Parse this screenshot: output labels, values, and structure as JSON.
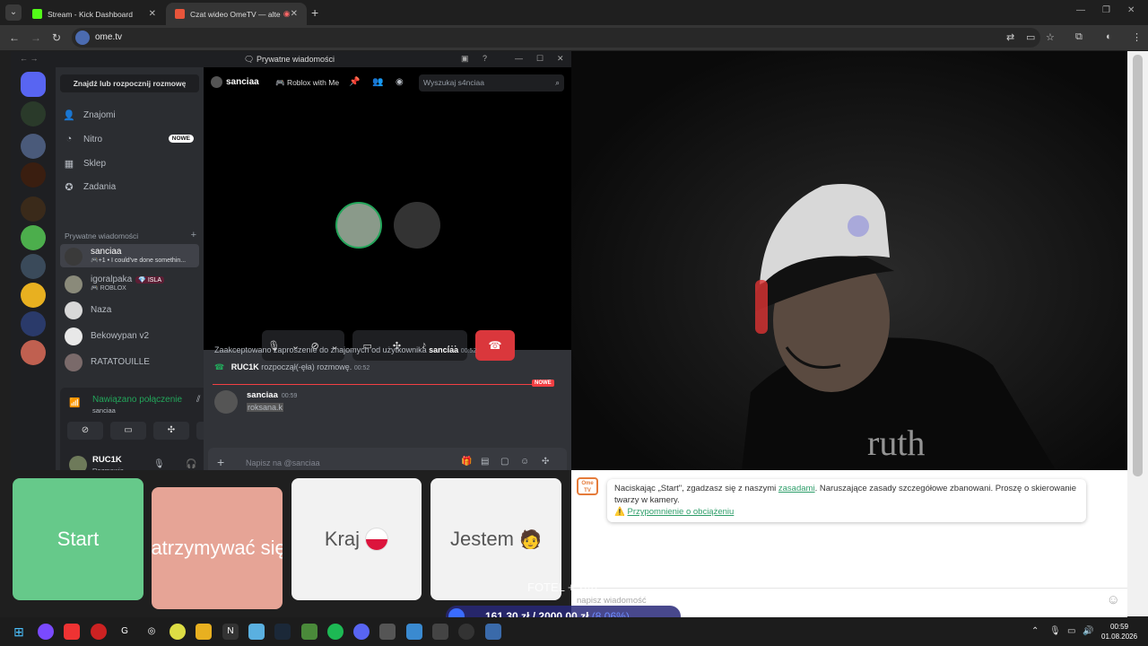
{
  "browser": {
    "tabs": [
      {
        "title": "Stream - Kick Dashboard",
        "fav_color": "#53fc18"
      },
      {
        "title": "Czat wideo OmeTV — altern",
        "fav_color": "#e8553b"
      }
    ],
    "url": "ome.tv"
  },
  "discord": {
    "window_title": "Prywatne wiadomości",
    "find_label": "Znajdź lub rozpocznij rozmowę",
    "nav": [
      {
        "label": "Znajomi",
        "icon": "friends-icon",
        "glyph": "👤"
      },
      {
        "label": "Nitro",
        "icon": "nitro-icon",
        "glyph": "◔",
        "badge": "NOWE"
      },
      {
        "label": "Sklep",
        "icon": "shop-icon",
        "glyph": "▦"
      },
      {
        "label": "Zadania",
        "icon": "quests-icon",
        "glyph": "✪"
      }
    ],
    "dm_header": "Prywatne wiadomości",
    "dms": [
      {
        "name": "sanciaa",
        "sub": "🎮+1 • I could've done somethin..."
      },
      {
        "name": "igoralpaka",
        "tag": "💎 ISLA",
        "sub": "🎮 ROBLOX"
      },
      {
        "name": "Naza",
        "sub": ""
      },
      {
        "name": "Bekowypan v2",
        "sub": ""
      },
      {
        "name": "RATATOUILLE",
        "sub": ""
      }
    ],
    "voice": {
      "status": "Nawiązano połączenie",
      "channel": "sanciaa",
      "user_name": "RUC1K",
      "user_status": "Rozmawia"
    },
    "chat": {
      "recipient": "sanciaa",
      "activity": "🎮 Roblox with Me",
      "search_placeholder": "Wyszukaj s4nciaa",
      "system1": {
        "text_prefix": "Zaakceptowano zaproszenie do znajomych od użytkownika",
        "user": "sanciaa",
        "time": "00:52"
      },
      "system2": {
        "user": "RUC1K",
        "text": "rozpoczął(-ęła) rozmowę.",
        "time": "00:52"
      },
      "new_label": "NOWE",
      "message": {
        "author": "sanciaa",
        "time": "00:59",
        "text": "roksana.k"
      },
      "composer_placeholder": "Napisz na @sanciaa"
    }
  },
  "ome": {
    "buttons": {
      "start": "Start",
      "stop": "Zatrzymywać się",
      "country": "Kraj",
      "country_flag": "🇵🇱",
      "gender": "Jestem",
      "gender_emoji": "🧑"
    },
    "logo": "Ome TV",
    "notice_prefix": "Naciskając „Start\", zgadzasz się z naszymi",
    "notice_link": "zasadami",
    "notice_suffix": ". Naruszające zasady szczegółowe zbanowani. Proszę o skierowanie twarzy w kamery.",
    "reminder_link": "Przypomnienie o obciążeniu",
    "message_placeholder": "napisz wiadomość"
  },
  "overlays": {
    "fotel": "FOTEL + 24h",
    "goal_current": "161,30 zł",
    "goal_sep": "/",
    "goal_target": "2000,00 zł",
    "goal_percent": "(8.06%)"
  },
  "taskbar": {
    "time": "00:59",
    "date": "01.08.2026"
  }
}
